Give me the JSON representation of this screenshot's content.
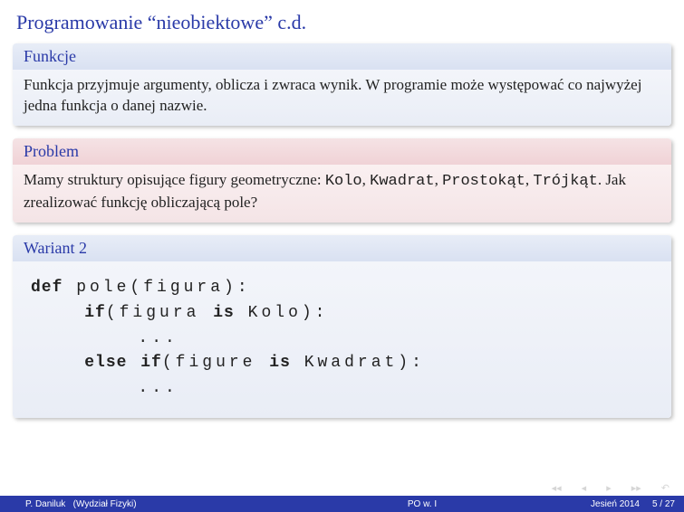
{
  "title": "Programowanie “nieobiektowe” c.d.",
  "blocks": {
    "funkcje": {
      "header": "Funkcje",
      "body": "Funkcja przyjmuje argumenty, oblicza i zwraca wynik. W programie może występować co najwyżej jedna funkcja o danej nazwie."
    },
    "problem": {
      "header": "Problem",
      "body_prefix": "Mamy struktury opisujące figury geometryczne: ",
      "code1": "Kolo",
      "sep1": ", ",
      "code2": "Kwadrat",
      "sep2": ", ",
      "code3": "Prostokąt",
      "sep3": ", ",
      "code4": "Trójkąt",
      "body_suffix": ". Jak zrealizować funkcję obliczającą pole?"
    },
    "wariant": {
      "header": "Wariant 2",
      "code": {
        "kw_def": "def",
        "line1_rest": " pole(figura):",
        "kw_if": "if",
        "line2_rest": "(figura ",
        "kw_is1": "is",
        "line2_rest2": " Kolo):",
        "line3": "        ...",
        "kw_else": "else",
        "space4": " ",
        "kw_if2": "if",
        "line4_rest": "(figure ",
        "kw_is2": "is",
        "line4_rest2": " Kwadrat):",
        "line5": "        ..."
      }
    }
  },
  "footer": {
    "author": "P. Daniluk",
    "affiliation": "(Wydział Fizyki)",
    "center": "PO w. I",
    "term": "Jesień 2014",
    "page": "5 / 27"
  }
}
